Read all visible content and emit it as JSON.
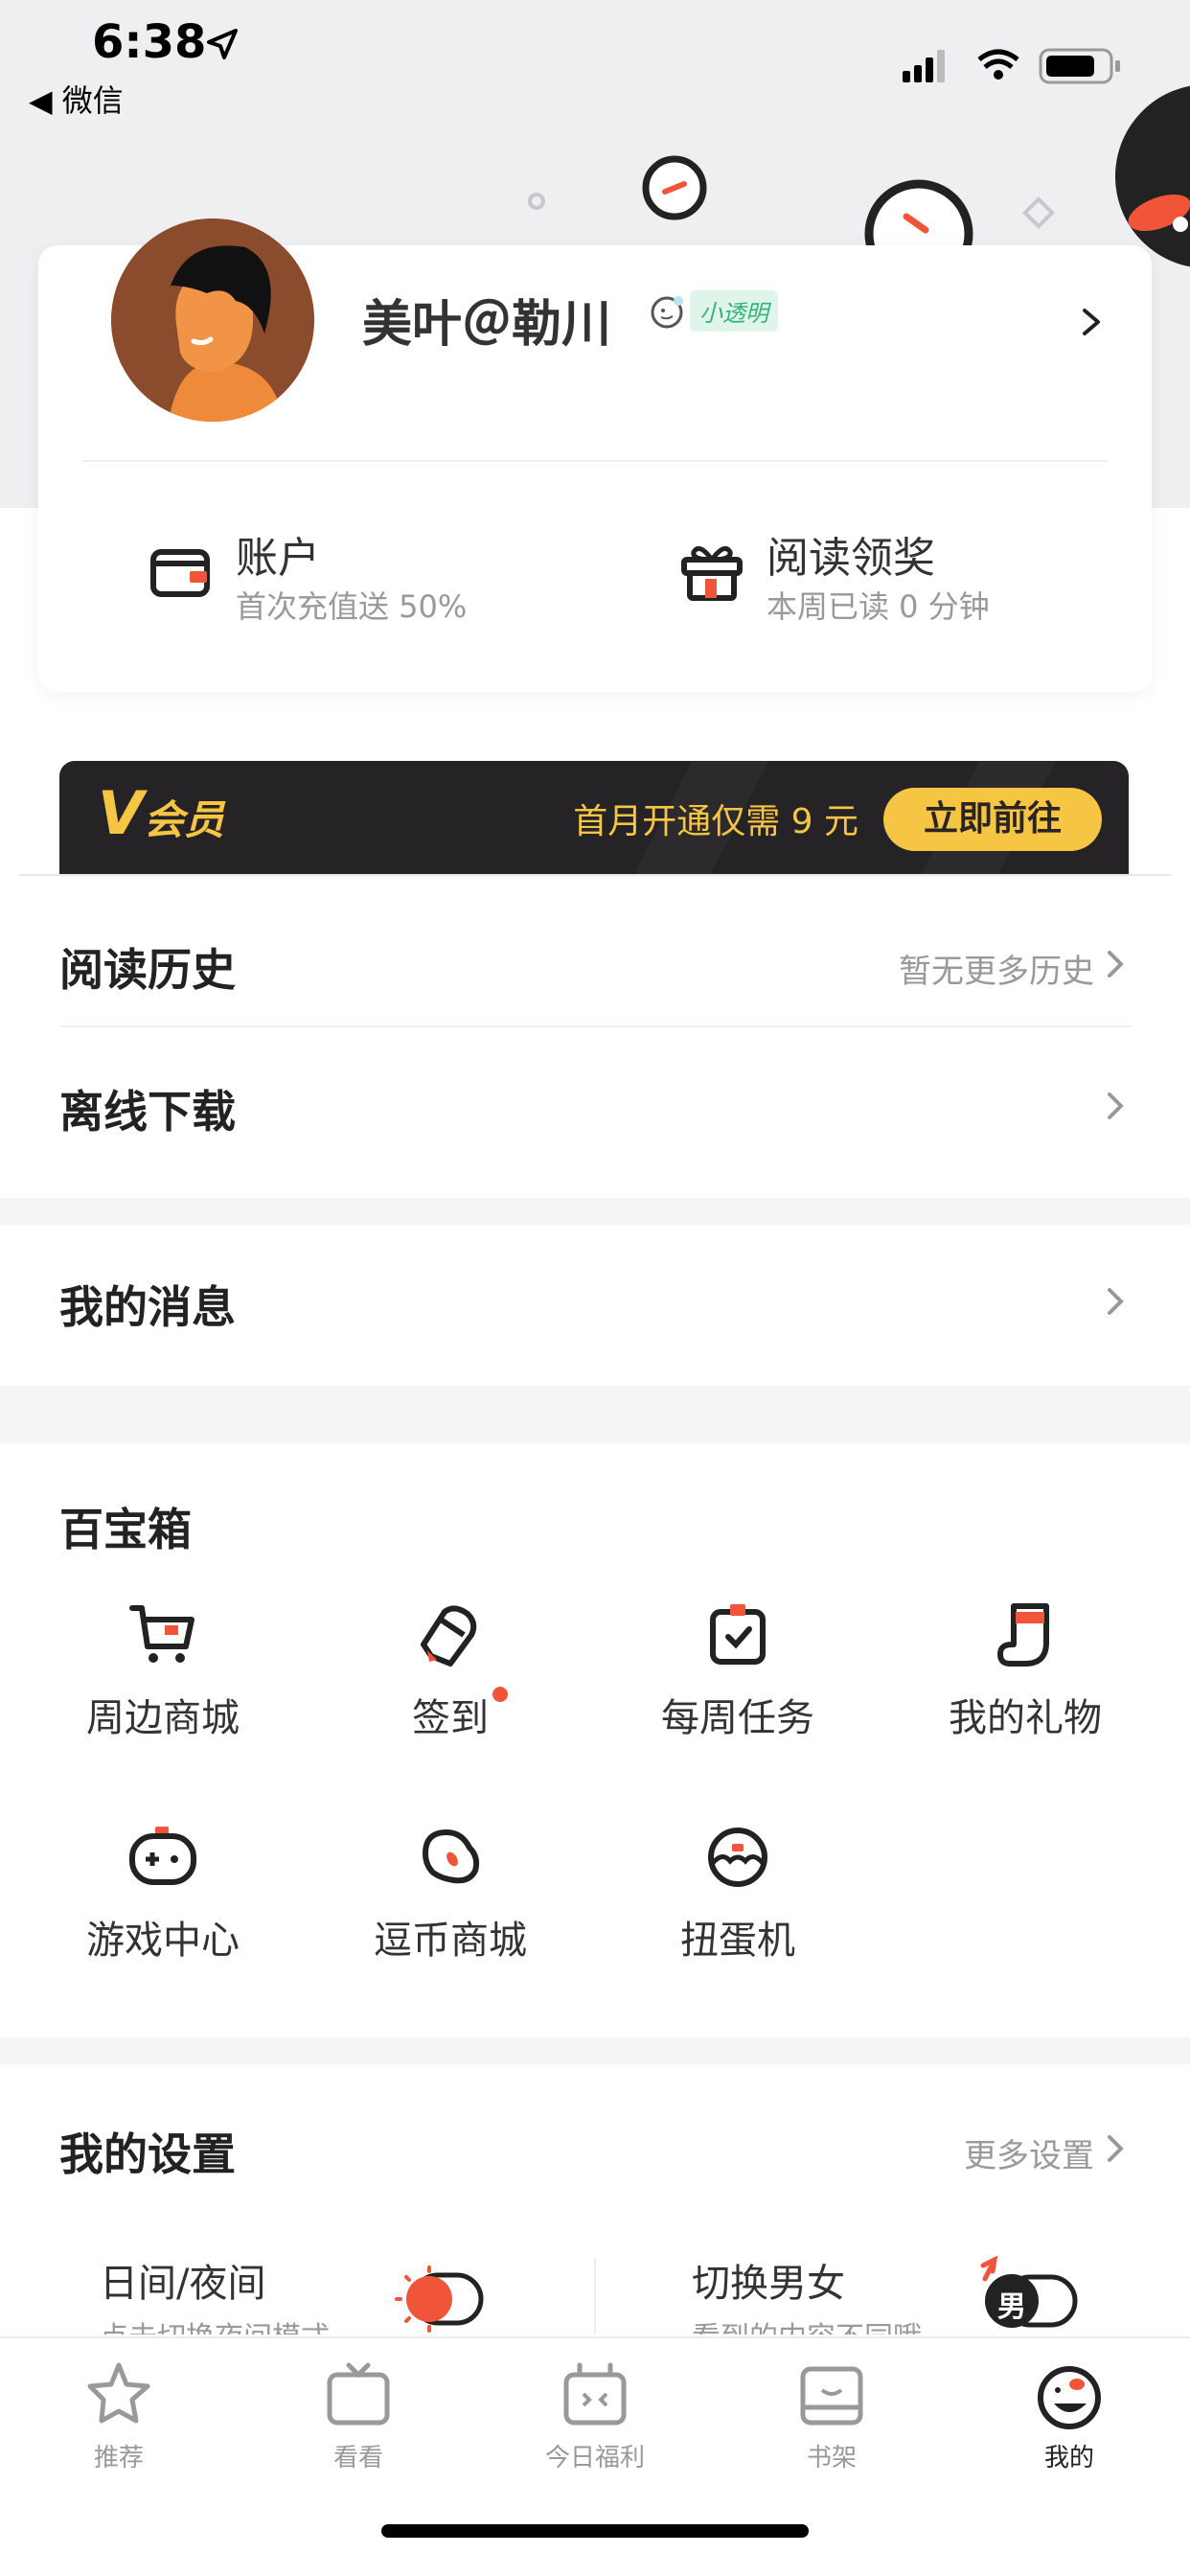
{
  "status_bar": {
    "time": "6:38",
    "back_app": "◀ 微信"
  },
  "profile": {
    "username": "美叶＠勒川",
    "badge": "小透明",
    "account": {
      "title": "账户",
      "subtitle": "首次充值送 50%"
    },
    "reading_reward": {
      "title": "阅读领奖",
      "subtitle": "本周已读 0 分钟"
    }
  },
  "vip": {
    "logo_v": "V",
    "logo_text": "会员",
    "promo": "首月开通仅需 9 元",
    "button": "立即前往"
  },
  "menu": {
    "reading_history": {
      "label": "阅读历史",
      "hint": "暂无更多历史"
    },
    "offline_download": {
      "label": "离线下载"
    },
    "my_messages": {
      "label": "我的消息"
    }
  },
  "toolbox": {
    "title": "百宝箱",
    "items": [
      {
        "label": "周边商城",
        "icon": "cart-icon"
      },
      {
        "label": "签到",
        "icon": "pen-icon",
        "dot": true
      },
      {
        "label": "每周任务",
        "icon": "task-icon"
      },
      {
        "label": "我的礼物",
        "icon": "sock-icon"
      },
      {
        "label": "游戏中心",
        "icon": "gamepad-icon"
      },
      {
        "label": "逗币商城",
        "icon": "bean-icon"
      },
      {
        "label": "扭蛋机",
        "icon": "capsule-icon"
      }
    ]
  },
  "settings": {
    "title": "我的设置",
    "more": "更多设置",
    "day_night": {
      "title": "日间/夜间",
      "subtitle": "点击切换夜间模式"
    },
    "gender": {
      "title": "切换男女",
      "subtitle": "看到的内容不同哦",
      "toggle_label": "男"
    }
  },
  "tabbar": {
    "items": [
      {
        "label": "推荐",
        "icon": "star-icon"
      },
      {
        "label": "看看",
        "icon": "tv-icon"
      },
      {
        "label": "今日福利",
        "icon": "gift-box-icon"
      },
      {
        "label": "书架",
        "icon": "bookshelf-icon"
      },
      {
        "label": "我的",
        "icon": "mine-face-icon",
        "active": true
      }
    ]
  },
  "colors": {
    "accent": "#f0553a",
    "vip_gold": "#f6c543",
    "vip_bg": "#252325",
    "badge_green": "#35b27a"
  }
}
